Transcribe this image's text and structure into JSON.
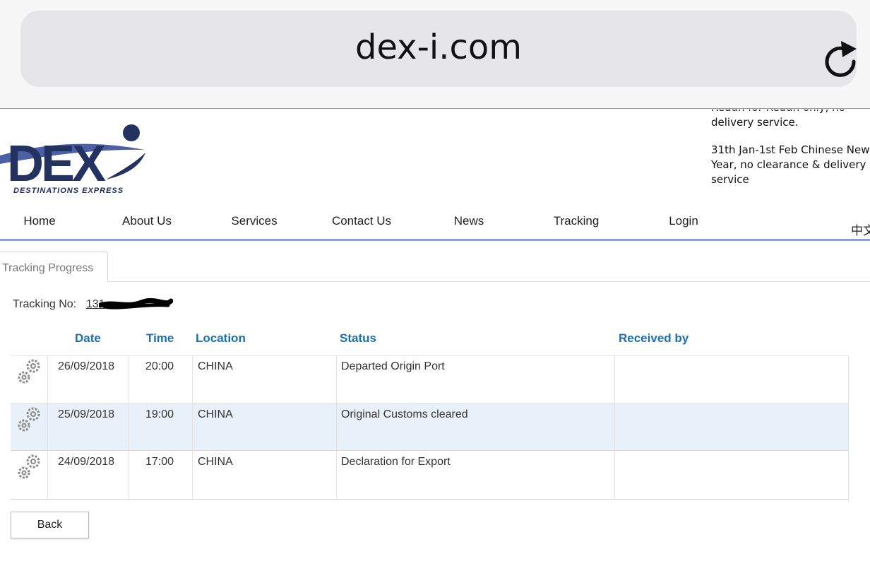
{
  "browser": {
    "url": "dex-i.com",
    "reload_icon": "reload-icon"
  },
  "brand": {
    "logo_text": "DEX",
    "tagline": "DESTINATIONS EXPRESS",
    "colors": {
      "navy": "#243262",
      "nav_line": "#8a9dd6",
      "link_blue": "#1a6fb8"
    }
  },
  "notice": {
    "line1_cut": "Redun for Redun only, no",
    "line1_rest": "delivery service.",
    "line2": "31th Jan-1st Feb Chinese New Year, no clearance & delivery service"
  },
  "nav": {
    "items": [
      "Home",
      "About Us",
      "Services",
      "Contact Us",
      "News",
      "Tracking",
      "Login"
    ],
    "lang": "中文"
  },
  "tabs": {
    "active": "Tracking Progress"
  },
  "tracking": {
    "label": "Tracking No:",
    "number": "131"
  },
  "table": {
    "headers": {
      "date": "Date",
      "time": "Time",
      "location": "Location",
      "status": "Status",
      "received_by": "Received by"
    },
    "rows": [
      {
        "icon": "gears-icon",
        "date": "26/09/2018",
        "time": "20:00",
        "location": "CHINA",
        "status": "Departed Origin Port",
        "received_by": ""
      },
      {
        "icon": "gears-icon",
        "date": "25/09/2018",
        "time": "19:00",
        "location": "CHINA",
        "status": "Original Customs cleared",
        "received_by": ""
      },
      {
        "icon": "gears-icon",
        "date": "24/09/2018",
        "time": "17:00",
        "location": "CHINA",
        "status": "Declaration for Export",
        "received_by": ""
      }
    ]
  },
  "actions": {
    "back_label": "Back"
  }
}
